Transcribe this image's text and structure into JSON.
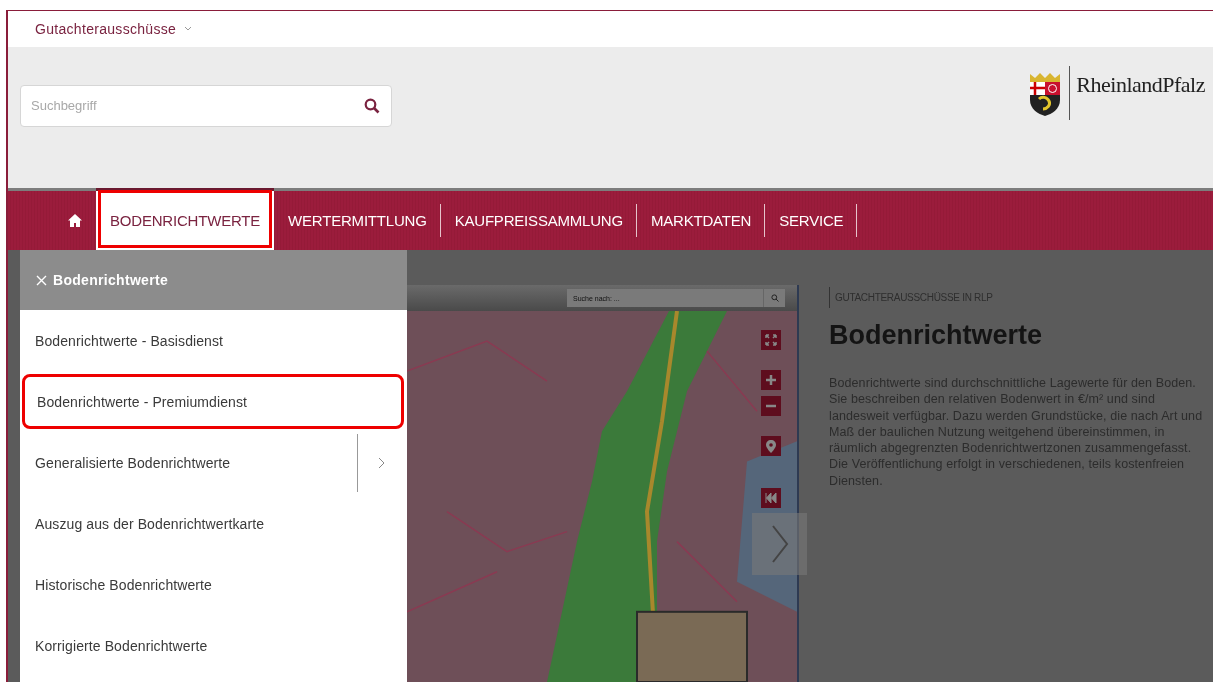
{
  "top_bar": {
    "site_menu": "Gutachterausschüsse"
  },
  "header": {
    "search": {
      "placeholder": "Suchbegriff"
    },
    "logo": {
      "wordmark": "RheinlandPfalz"
    }
  },
  "nav": {
    "items": [
      {
        "label": "BODENRICHTWERTE",
        "selected": true,
        "highlighted": true
      },
      {
        "label": "WERTERMITTLUNG",
        "selected": false,
        "highlighted": false
      },
      {
        "label": "KAUFPREISSAMMLUNG",
        "selected": false,
        "highlighted": false
      },
      {
        "label": "MARKTDATEN",
        "selected": false,
        "highlighted": false
      },
      {
        "label": "SERVICE",
        "selected": false,
        "highlighted": false
      }
    ]
  },
  "menu": {
    "title": "Bodenrichtwerte",
    "items": [
      {
        "label": "Bodenrichtwerte - Basisdienst",
        "highlighted": false,
        "has_submenu": false
      },
      {
        "label": "Bodenrichtwerte - Premiumdienst",
        "highlighted": true,
        "has_submenu": false
      },
      {
        "label": "Generalisierte Bodenrichtwerte",
        "highlighted": false,
        "has_submenu": true
      },
      {
        "label": "Auszug aus der Bodenrichtwertkarte",
        "highlighted": false,
        "has_submenu": false
      },
      {
        "label": "Historische Bodenrichtwerte",
        "highlighted": false,
        "has_submenu": false
      },
      {
        "label": "Korrigierte Bodenrichtwerte",
        "highlighted": false,
        "has_submenu": false
      }
    ]
  },
  "map": {
    "search": {
      "placeholder": "Suche nach: ..."
    }
  },
  "intro": {
    "eyebrow": "GUTACHTERAUSSCHÜSSE IN RLP",
    "heading": "Bodenrichtwerte",
    "body": "Bodenrichtwerte sind durchschnittliche Lagewerte für den Boden. Sie beschreiben den relativen Bodenwert in €/m² und sind landesweit verfügbar. Dazu werden Grundstücke, die nach Art und Maß der baulichen Nutzung weitgehend übereinstimmen, in räumlich abgegrenzten Bodenrichtwertzonen zusammengefasst. Die Veröffentlichung erfolgt in verschiedenen, teils kostenfreien Diensten."
  }
}
